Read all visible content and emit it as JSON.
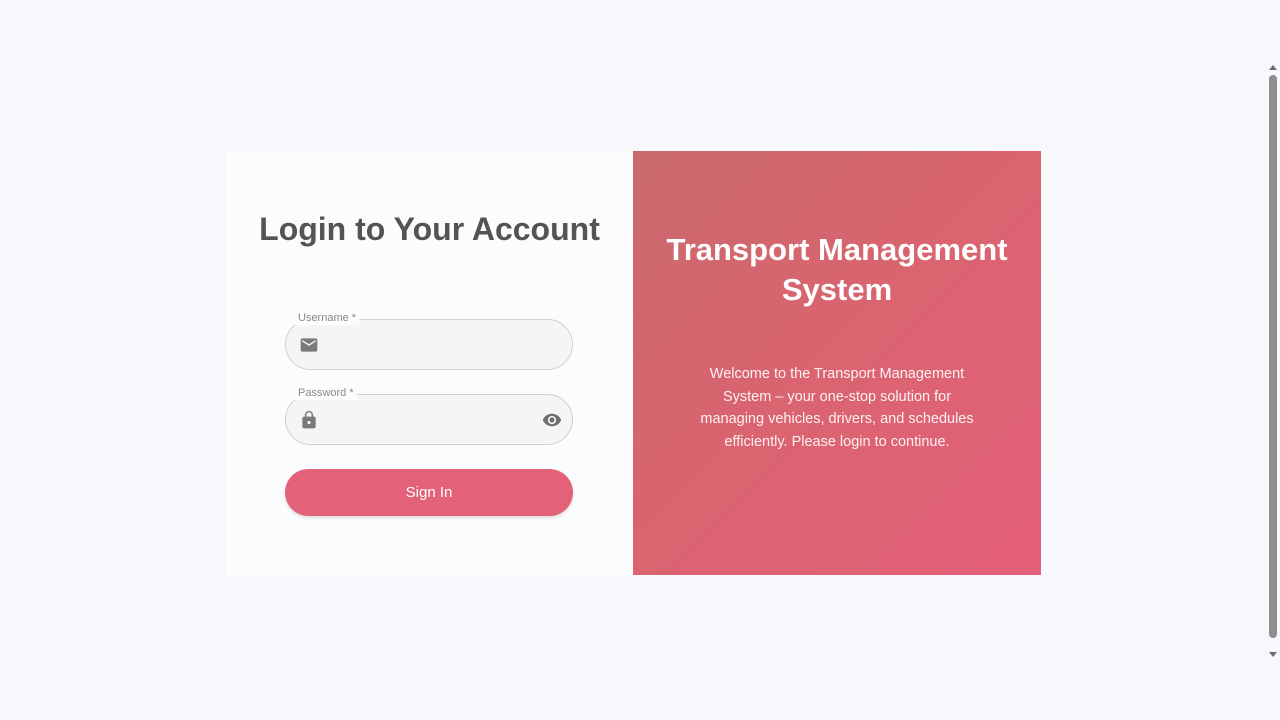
{
  "login": {
    "title": "Login to Your Account",
    "username_label": "Username *",
    "username_value": "",
    "password_label": "Password *",
    "password_value": "",
    "sign_in_label": "Sign In",
    "icons": {
      "username": "mail-icon",
      "password": "lock-icon",
      "toggle_visibility": "eye-icon"
    }
  },
  "info": {
    "title": "Transport Management System",
    "description": "Welcome to the Transport Management System – your one-stop solution for managing vehicles, drivers, and schedules efficiently. Please login to continue."
  },
  "colors": {
    "accent": "#e3627a",
    "panel_gradient_start": "#c96a6e",
    "panel_gradient_end": "#e5607a",
    "heading": "#545454",
    "page_background": "#f6f8fb"
  }
}
